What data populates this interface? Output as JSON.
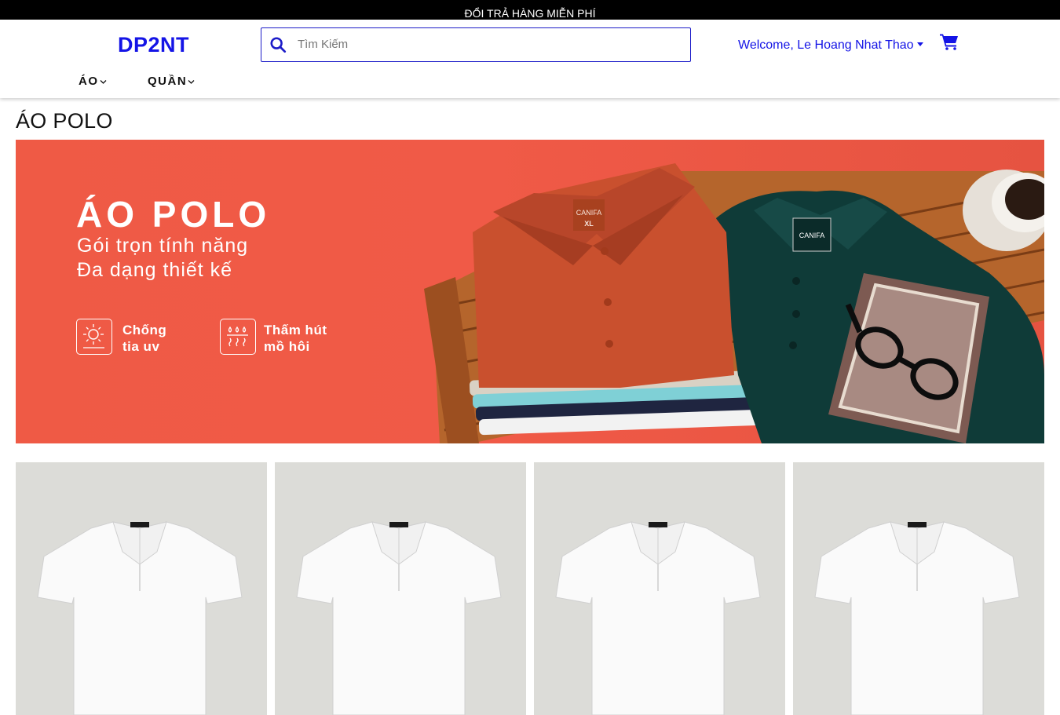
{
  "announcement": "ĐỔI TRẢ HÀNG MIỄN PHÍ",
  "header": {
    "logo": "DP2NT",
    "search_placeholder": "Tìm Kiếm",
    "welcome": "Welcome, Le Hoang Nhat Thao",
    "nav": [
      {
        "label": "ÁO"
      },
      {
        "label": "QUẦN"
      }
    ]
  },
  "page": {
    "title": "ÁO POLO"
  },
  "banner": {
    "title": "ÁO POLO",
    "subtitle_line1": "Gói trọn tính năng",
    "subtitle_line2": "Đa dạng thiết kế",
    "features": [
      {
        "line1": "Chống",
        "line2": "tia uv",
        "icon": "uv-protection-icon"
      },
      {
        "line1": "Thấm hút",
        "line2": "mồ hôi",
        "icon": "sweat-absorb-icon"
      }
    ],
    "shirt_labels": [
      "CANIFA",
      "XL"
    ],
    "colors": {
      "background": "#ef5a45",
      "shirt_orange": "#c9502e",
      "shirt_green": "#0f3b38"
    }
  },
  "products": [
    {
      "image": "white-polo-shirt"
    },
    {
      "image": "white-polo-shirt"
    },
    {
      "image": "white-polo-shirt"
    },
    {
      "image": "white-polo-shirt"
    }
  ],
  "colors": {
    "brand": "#1414e6",
    "announce_bg": "#000000",
    "card_bg": "#dcdcd8"
  }
}
